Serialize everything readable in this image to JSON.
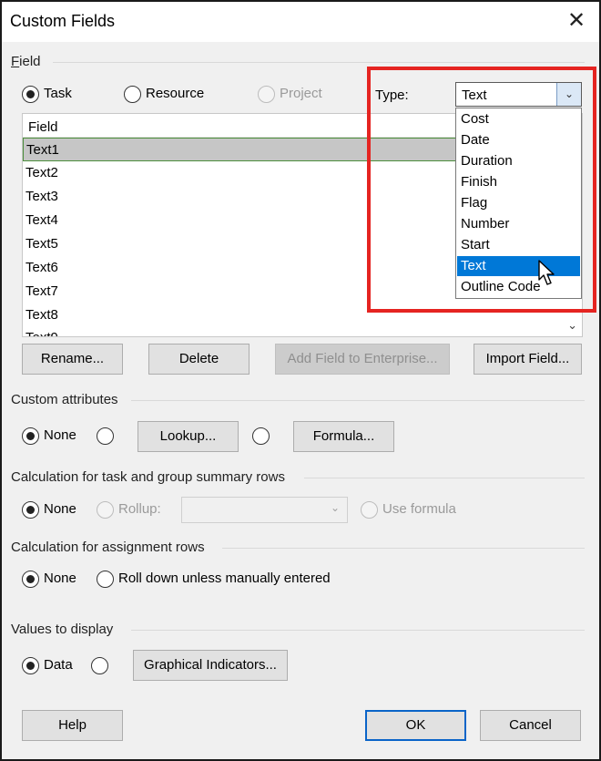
{
  "window": {
    "title": "Custom Fields",
    "close_label": "✕"
  },
  "field_section": {
    "label": "Field",
    "scope_options": [
      {
        "label": "Task",
        "checked": true,
        "disabled": false
      },
      {
        "label": "Resource",
        "checked": false,
        "disabled": false
      },
      {
        "label": "Project",
        "checked": false,
        "disabled": true
      }
    ],
    "type_label": "Type:",
    "type_value": "Text",
    "type_options": [
      "Cost",
      "Date",
      "Duration",
      "Finish",
      "Flag",
      "Number",
      "Start",
      "Text",
      "Outline Code"
    ],
    "type_highlighted": "Text"
  },
  "field_list": {
    "header": "Field",
    "rows": [
      "Text1",
      "Text2",
      "Text3",
      "Text4",
      "Text5",
      "Text6",
      "Text7",
      "Text8"
    ],
    "selected": "Text1"
  },
  "buttons": {
    "rename": "Rename...",
    "delete": "Delete",
    "add_to_enterprise": "Add Field to Enterprise...",
    "import_field": "Import Field...",
    "lookup": "Lookup...",
    "formula": "Formula...",
    "graphical_indicators": "Graphical Indicators...",
    "help": "Help",
    "ok": "OK",
    "cancel": "Cancel"
  },
  "custom_attributes": {
    "label": "Custom attributes",
    "none_label": "None"
  },
  "task_summary": {
    "label": "Calculation for task and group summary rows",
    "none_label": "None",
    "rollup_label": "Rollup:",
    "use_formula_label": "Use formula"
  },
  "assignment_rows": {
    "label": "Calculation for assignment rows",
    "none_label": "None",
    "rolldown_label": "Roll down unless manually entered"
  },
  "values_to_display": {
    "label": "Values to display",
    "data_label": "Data"
  },
  "colors": {
    "highlight": "#0078d7",
    "annotation_frame": "#e52421",
    "selected_row": "#c6c6c6",
    "dialog_bg": "#f0f0f0"
  }
}
